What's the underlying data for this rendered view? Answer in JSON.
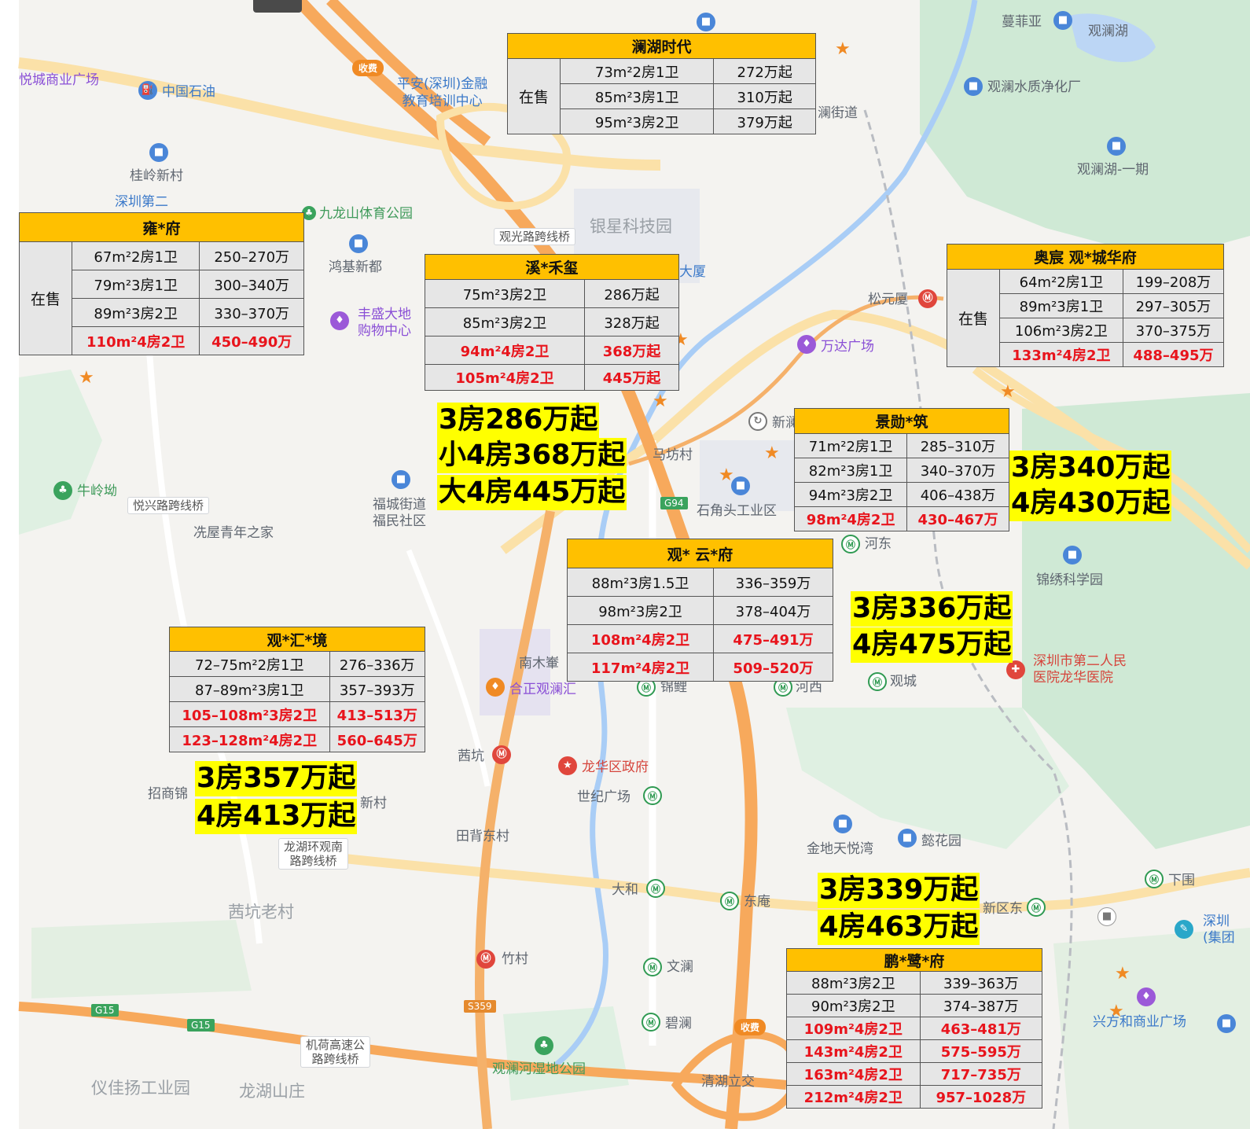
{
  "map": {
    "colors": {
      "land": "#f4f3f0",
      "park": "#cfe9d5",
      "water": "#bcd6f5",
      "expressway": "#f7a95c",
      "arterial": "#fbe1a8"
    },
    "places": {
      "yuecheng_mall": "悦城商业广场",
      "sinopec": "中国石油",
      "pingan": "平安(深圳)金融\n教育培训中心",
      "guilingxin": "桂岭新村",
      "shenzhen2": "深圳第二",
      "jiulongshan": "九龙山体育公园",
      "hongji": "鸿基新都",
      "fengsheng": "丰盛大地\n购物中心",
      "yinxing": "银星科技园",
      "dasha": "大厦",
      "songyuansha": "松元厦",
      "wanda": "万达广场",
      "xinlan": "新澜",
      "mafang": "马坊村",
      "shijiaotou": "石角头工业区",
      "hedong": "河东",
      "jinxiu": "锦绣科学园",
      "lanjiedao": "澜街道",
      "manfeiya": "蔓菲亚",
      "guanlanhu": "观澜湖",
      "guanlan_water": "观澜水质净化厂",
      "guanlanhu1": "观澜湖-一期",
      "niulingao": "牛岭坳",
      "xiwu": "冼屋青年之家",
      "fucheng": "福城街道\n福民社区",
      "nanmu": "南木輋",
      "hezheng": "合正观澜汇",
      "jinli": "锦鲤",
      "hexi": "河西",
      "guancheng": "观城",
      "hospital": "深圳市第二人民\n医院龙华医院",
      "qiankeng": "茜坑",
      "longhua_gov": "龙华区政府",
      "shiji": "世纪广场",
      "zhaoshang": "招商锦",
      "xincun": "新村",
      "tianbei": "田背东村",
      "qiankeng_old": "茜坑老村",
      "jindi": "金地天悦湾",
      "yihua": "懿花园",
      "dahe": "大和",
      "dongan": "东庵",
      "xinqudong": "新区东",
      "xiawei": "下围",
      "shenzhen_right": "深圳\n(集团",
      "zhucun": "竹村",
      "wenlan": "文澜",
      "bilan": "碧澜",
      "wetland": "观澜河湿地公园",
      "qinghu": "清湖立交",
      "xingfang": "兴方和商业广场",
      "yijiayang": "仪佳扬工业园",
      "longhu": "龙湖山庄"
    },
    "bridges": {
      "guanguang": "观光路跨线桥",
      "yuexing": "悦兴路跨线桥",
      "longhuan": "龙湖环观南\n路跨线桥",
      "jihe": "机荷高速公\n路跨线桥"
    },
    "toll": "收费",
    "road_shields": {
      "g94": "G94",
      "g15": "G15",
      "s359": "S359"
    },
    "icons": {
      "metro": "metro-icon",
      "poi": "building-icon",
      "mall": "mall-icon",
      "scenic": "star-icon"
    }
  },
  "projects": {
    "lanhu": {
      "title": "澜湖时代",
      "status": "在售",
      "rows": [
        {
          "unit": "73m²2房1卫",
          "price": "272万起",
          "hot": false
        },
        {
          "unit": "85m²3房1卫",
          "price": "310万起",
          "hot": false
        },
        {
          "unit": "95m²3房2卫",
          "price": "379万起",
          "hot": false
        }
      ]
    },
    "yongfu": {
      "title": "雍*府",
      "status": "在售",
      "rows": [
        {
          "unit": "67m²2房1卫",
          "price": "250–270万",
          "hot": false
        },
        {
          "unit": "79m²3房1卫",
          "price": "300–340万",
          "hot": false
        },
        {
          "unit": "89m²3房2卫",
          "price": "330–370万",
          "hot": false
        },
        {
          "unit": "110m²4房2卫",
          "price": "450–490万",
          "hot": true
        }
      ]
    },
    "xihexi": {
      "title": "溪*禾玺",
      "rows": [
        {
          "unit": "75m²3房2卫",
          "price": "286万起",
          "hot": false
        },
        {
          "unit": "85m²3房2卫",
          "price": "328万起",
          "hot": false
        },
        {
          "unit": "94m²4房2卫",
          "price": "368万起",
          "hot": true
        },
        {
          "unit": "105m²4房2卫",
          "price": "445万起",
          "hot": true
        }
      ],
      "summary": [
        "3房286万起",
        "小4房368万起",
        "大4房445万起"
      ]
    },
    "aochen": {
      "title": "奥宸 观*城华府",
      "status": "在售",
      "rows": [
        {
          "unit": "64m²2房1卫",
          "price": "199–208万",
          "hot": false
        },
        {
          "unit": "89m²3房1卫",
          "price": "297–305万",
          "hot": false
        },
        {
          "unit": "106m²3房2卫",
          "price": "370–375万",
          "hot": false
        },
        {
          "unit": "133m²4房2卫",
          "price": "488–495万",
          "hot": true
        }
      ]
    },
    "jingxun": {
      "title": "景勋*筑",
      "rows": [
        {
          "unit": "71m²2房1卫",
          "price": "285–310万",
          "hot": false
        },
        {
          "unit": "82m²3房1卫",
          "price": "340–370万",
          "hot": false
        },
        {
          "unit": "94m²3房2卫",
          "price": "406–438万",
          "hot": false
        },
        {
          "unit": "98m²4房2卫",
          "price": "430–467万",
          "hot": true
        }
      ],
      "summary": [
        "3房340万起",
        "4房430万起"
      ]
    },
    "guanyun": {
      "title": "观* 云*府",
      "rows": [
        {
          "unit": "88m²3房1.5卫",
          "price": "336–359万",
          "hot": false
        },
        {
          "unit": "98m²3房2卫",
          "price": "378–404万",
          "hot": false
        },
        {
          "unit": "108m²4房2卫",
          "price": "475–491万",
          "hot": true
        },
        {
          "unit": "117m²4房2卫",
          "price": "509–520万",
          "hot": true
        }
      ],
      "summary": [
        "3房336万起",
        "4房475万起"
      ]
    },
    "guanhui": {
      "title": "观*汇*境",
      "rows": [
        {
          "unit": "72–75m²2房1卫",
          "price": "276–336万",
          "hot": false
        },
        {
          "unit": "87–89m²3房1卫",
          "price": "357–393万",
          "hot": false
        },
        {
          "unit": "105–108m²3房2卫",
          "price": "413–513万",
          "hot": true
        },
        {
          "unit": "123–128m²4房2卫",
          "price": "560–645万",
          "hot": true
        }
      ],
      "summary": [
        "3房357万起",
        "4房413万起"
      ]
    },
    "pengfu": {
      "title": "鹏*鹭*府",
      "rows": [
        {
          "unit": "88m²3房2卫",
          "price": "339–363万",
          "hot": false
        },
        {
          "unit": "90m²3房2卫",
          "price": "374–387万",
          "hot": false
        },
        {
          "unit": "109m²4房2卫",
          "price": "463–481万",
          "hot": true
        },
        {
          "unit": "143m²4房2卫",
          "price": "575–595万",
          "hot": true
        },
        {
          "unit": "163m²4房2卫",
          "price": "717–735万",
          "hot": true
        },
        {
          "unit": "212m²4房2卫",
          "price": "957–1028万",
          "hot": true
        }
      ],
      "summary": [
        "3房339万起",
        "4房463万起"
      ]
    }
  }
}
